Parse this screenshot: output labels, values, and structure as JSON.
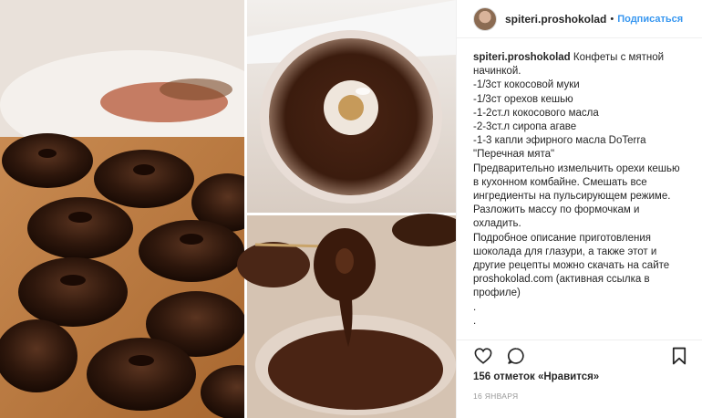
{
  "post": {
    "username": "spiteri.proshokolad",
    "separator": "•",
    "follow_label": "Подписаться"
  },
  "caption": {
    "username": "spiteri.proshokolad",
    "lines": [
      "Конфеты с мятной начинкой.",
      "-1/3ст кокосовой муки",
      "-1/3ст орехов кешью",
      "-1-2ст.л кокосового масла",
      "-2-3ст.л сиропа агаве",
      "-1-3 капли эфирного масла DoTerra \"Перечная мята\"",
      "Предварительно измельчить орехи кешью в кухонном комбайне. Смешать все ингредиенты на пульсирующем режиме. Разложить массу по формочкам и охладить.",
      "Подробное описание приготовления шоколада для глазури, а также этот и другие рецепты можно скачать на сайте proshokolad.com (активная ссылка в профиле)",
      ".",
      "."
    ]
  },
  "actions": {
    "like_icon": "heart-icon",
    "comment_icon": "comment-icon",
    "save_icon": "bookmark-icon"
  },
  "likes_text": "156 отметок «Нравится»",
  "date_text": "16 ЯНВАРЯ",
  "colors": {
    "link": "#3897f0",
    "text": "#262626",
    "muted": "#999999",
    "border": "#efefef"
  }
}
